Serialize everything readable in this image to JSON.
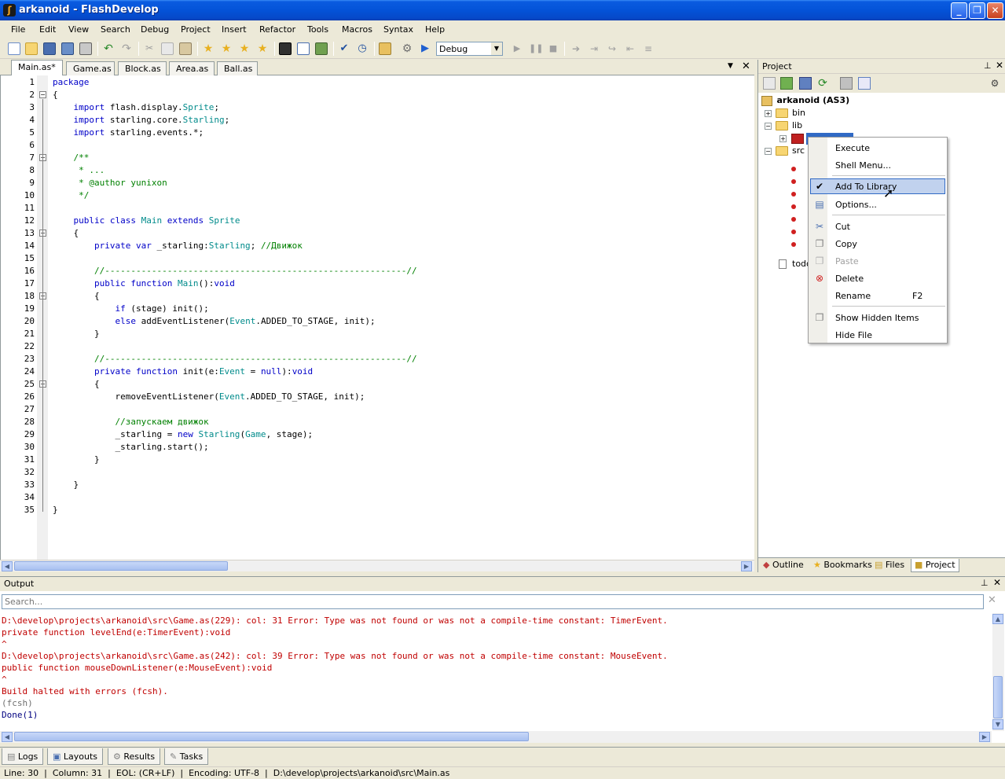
{
  "window": {
    "title": "arkanoid - FlashDevelop",
    "icon": "flashdevelop-icon"
  },
  "menu": [
    "File",
    "Edit",
    "View",
    "Search",
    "Debug",
    "Project",
    "Insert",
    "Refactor",
    "Tools",
    "Macros",
    "Syntax",
    "Help"
  ],
  "toolbar": {
    "config_value": "Debug"
  },
  "editor": {
    "tabs": [
      "Main.as*",
      "Game.as",
      "Block.as",
      "Area.as",
      "Ball.as"
    ],
    "active_tab": 0,
    "lines": [
      "package",
      "{",
      "    import flash.display.Sprite;",
      "    import starling.core.Starling;",
      "    import starling.events.*;",
      "",
      "    /**",
      "     * ...",
      "     * @author yunixon",
      "     */",
      "",
      "    public class Main extends Sprite",
      "    {",
      "        private var _starling:Starling; //Движок",
      "",
      "        //----------------------------------------------------------//",
      "        public function Main():void",
      "        {",
      "            if (stage) init();",
      "            else addEventListener(Event.ADDED_TO_STAGE, init);",
      "        }",
      "",
      "        //----------------------------------------------------------//",
      "        private function init(e:Event = null):void",
      "        {",
      "            removeEventListener(Event.ADDED_TO_STAGE, init);",
      "",
      "            //запускаем движок",
      "            _starling = new Starling(Game, stage);",
      "            _starling.start();",
      "        }",
      "",
      "    }",
      "",
      "}"
    ]
  },
  "project": {
    "header": "Project",
    "root": "arkanoid (AS3)",
    "items": [
      "bin",
      "lib",
      "src",
      "todo"
    ]
  },
  "context_menu": {
    "items": [
      {
        "label": "Execute",
        "shortcut": ""
      },
      {
        "label": "Shell Menu...",
        "shortcut": ""
      },
      {
        "label": "Add To Library",
        "shortcut": ""
      },
      {
        "label": "Options...",
        "shortcut": ""
      },
      {
        "label": "Cut",
        "shortcut": ""
      },
      {
        "label": "Copy",
        "shortcut": ""
      },
      {
        "label": "Paste",
        "shortcut": ""
      },
      {
        "label": "Delete",
        "shortcut": ""
      },
      {
        "label": "Rename",
        "shortcut": "F2"
      },
      {
        "label": "Show Hidden Items",
        "shortcut": ""
      },
      {
        "label": "Hide File",
        "shortcut": ""
      }
    ]
  },
  "project_tabs": [
    "Outline",
    "Bookmarks",
    "Files",
    "Project"
  ],
  "output": {
    "header": "Output",
    "search_placeholder": "Search...",
    "lines": [
      "D:\\develop\\projects\\arkanoid\\src\\Game.as(229): col: 31 Error: Type was not found or was not a compile-time constant: TimerEvent.",
      "private function levelEnd(e:TimerEvent):void",
      "^",
      "D:\\develop\\projects\\arkanoid\\src\\Game.as(242): col: 39 Error: Type was not found or was not a compile-time constant: MouseEvent.",
      "public function mouseDownListener(e:MouseEvent):void",
      "^",
      "Build halted with errors (fcsh).",
      "(fcsh)",
      "Done(1)"
    ]
  },
  "bottom_tabs": [
    "Logs",
    "Layouts",
    "Results",
    "Tasks"
  ],
  "status": {
    "line": "Line: 30",
    "column": "Column: 31",
    "eol": "EOL: (CR+LF)",
    "encoding": "Encoding: UTF-8",
    "path": "D:\\develop\\projects\\arkanoid\\src\\Main.as"
  }
}
